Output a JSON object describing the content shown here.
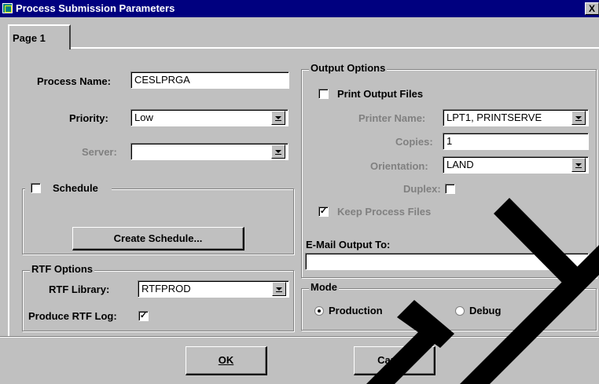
{
  "window": {
    "title": "Process Submission Parameters",
    "close_label": "X"
  },
  "tabs": [
    {
      "label": "Page 1"
    }
  ],
  "process": {
    "name_label": "Process Name:",
    "name_value": "CESLPRGA",
    "priority_label": "Priority:",
    "priority_value": "Low",
    "server_label": "Server:",
    "server_value": ""
  },
  "schedule": {
    "label": "Schedule",
    "checked": false,
    "button_label": "Create Schedule..."
  },
  "rtf": {
    "group_label": "RTF Options",
    "library_label": "RTF Library:",
    "library_value": "RTFPROD",
    "log_label": "Produce RTF Log:",
    "log_checked": true
  },
  "output": {
    "group_label": "Output Options",
    "print_label": "Print Output Files",
    "print_checked": false,
    "printer_label": "Printer Name:",
    "printer_value": "LPT1, PRINTSERVE",
    "copies_label": "Copies:",
    "copies_value": "1",
    "orientation_label": "Orientation:",
    "orientation_value": "LAND",
    "duplex_label": "Duplex:",
    "duplex_checked": false,
    "keep_label": "Keep Process Files",
    "keep_checked": true,
    "email_label": "E-Mail Output To:",
    "email_value": ""
  },
  "mode": {
    "group_label": "Mode",
    "options": [
      {
        "label": "Production",
        "selected": true
      },
      {
        "label": "Debug",
        "selected": false
      }
    ]
  },
  "buttons": {
    "ok_label": "OK",
    "cancel_label": "Cancel"
  },
  "colors": {
    "titlebar": "#00007f",
    "face": "#c0c0c0",
    "watermark": "#000000"
  }
}
